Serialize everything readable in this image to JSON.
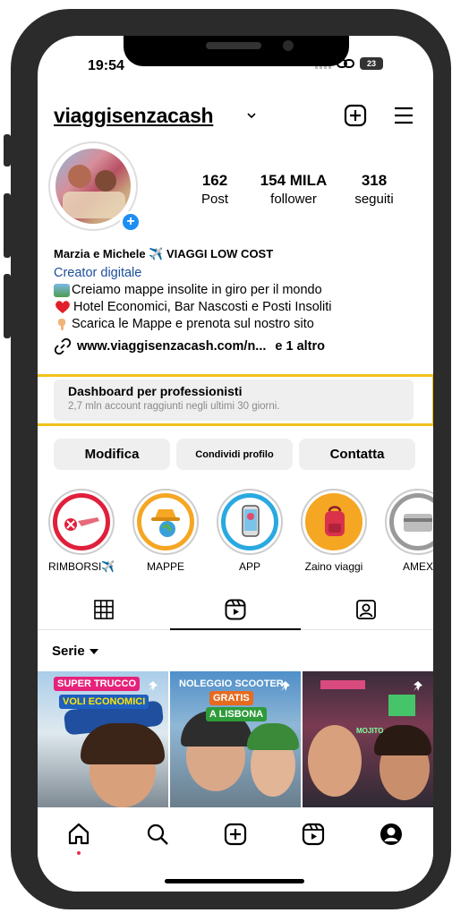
{
  "status_bar": {
    "time": "19:54",
    "battery": "23"
  },
  "header": {
    "username": "viaggisenzacash",
    "icons": [
      "chevron-down-icon",
      "new-post-icon",
      "menu-icon"
    ]
  },
  "profile": {
    "stats": [
      {
        "value": "162",
        "label": "Post"
      },
      {
        "value": "154 MILA",
        "label": "follower"
      },
      {
        "value": "318",
        "label": "seguiti"
      }
    ],
    "name": "Marzia e Michele ✈️ VIAGGI LOW COST",
    "category": "Creator digitale",
    "bio_lines": [
      "Creiamo mappe insolite in giro per il mondo",
      "Hotel Economici, Bar Nascosti e Posti Insoliti",
      "Scarica le Mappe e prenota sul nostro sito"
    ],
    "link": "www.viaggisenzacash.com/n...",
    "link_more": "e 1 altro"
  },
  "dashboard": {
    "title": "Dashboard per professionisti",
    "subtitle": "2,7 mln account raggiunti negli ultimi 30 giorni."
  },
  "buttons": {
    "edit": "Modifica",
    "share": "Condividi profilo",
    "contact": "Contatta"
  },
  "highlights": [
    {
      "label": "RIMBORSI✈️",
      "icon": "refund-plane-icon",
      "color": "#e0203b"
    },
    {
      "label": "MAPPE",
      "icon": "map-hat-icon",
      "color": "#f5a623"
    },
    {
      "label": "APP",
      "icon": "phone-app-icon",
      "color": "#2aa9e0"
    },
    {
      "label": "Zaino viaggi",
      "icon": "backpack-icon",
      "color": "#f5a623"
    },
    {
      "label": "AMEX",
      "icon": "card-icon",
      "color": "#9a9a9a"
    }
  ],
  "filter": {
    "label": "Serie"
  },
  "posts": [
    {
      "lines": [
        "SUPER TRUCCO",
        "VOLI ECONOMICI"
      ],
      "pinned": true
    },
    {
      "lines": [
        "NOLEGGIO SCOOTER",
        "GRATIS",
        "A LISBONA"
      ],
      "pinned": true
    },
    {
      "lines": [
        "MOJITO"
      ],
      "pinned": true
    }
  ]
}
